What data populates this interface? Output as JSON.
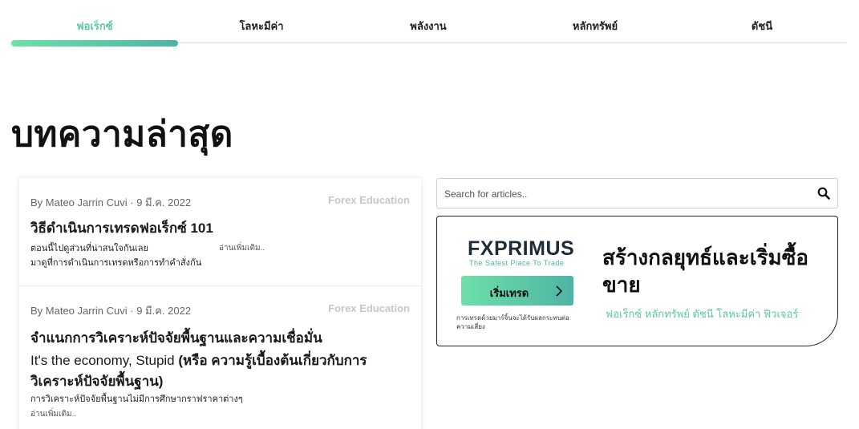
{
  "tabs": [
    {
      "label": "ฟอเร็กซ์",
      "active": true
    },
    {
      "label": "โลหะมีค่า",
      "active": false
    },
    {
      "label": "พลังงาน",
      "active": false
    },
    {
      "label": "หลักทรัพย์",
      "active": false
    },
    {
      "label": "ดัชนี",
      "active": false
    }
  ],
  "page_title": "บทความล่าสุด",
  "articles": [
    {
      "meta": "By Mateo Jarrin Cuvi · 9 มี.ค. 2022",
      "category": "Forex Education",
      "title": "วิธีดำเนินการเทรดฟอเร็กซ์ 101",
      "excerpt_line1": "ตอนนี้ไปดูส่วนที่น่าสนใจกันเลย",
      "excerpt_line2": "มาดูที่การดำเนินการเทรดหรือการทำคำสั่งกัน",
      "read_more": "อ่านเพิ่มเติม.."
    },
    {
      "meta": "By Mateo Jarrin Cuvi · 9 มี.ค. 2022",
      "category": "Forex Education",
      "title": "จำแนกการวิเคราะห์ปัจจัยพื้นฐานและความเชื่อมั่น",
      "subtitle_plain": "It's the economy, Stupid ",
      "subtitle_bold": "(หรือ ความรู้เบื้องต้นเกี่ยวกับการวิเคราะห์ปัจจัยพื้นฐาน)",
      "excerpt_line1": "การวิเคราะห์ปัจจัยพื้นฐานไม่มีการศึกษากราฟราคาต่างๆ",
      "read_more": "อ่านเพิ่มเติม.."
    }
  ],
  "search": {
    "placeholder": "Search for articles..",
    "icon": "search-icon"
  },
  "promo": {
    "logo": "FXPRIMUS",
    "tagline": "The Safest Place To Trade",
    "cta_label": "เริ่มเทรด",
    "disclaimer": "การเทรดด้วยมาร์จิ้นจะได้รับผลกระทบต่อความเสี่ยง",
    "title": "สร้างกลยุทธ์และเริ่มซื้อขาย",
    "tags": "ฟอเร็กซ์ หลักทรัพย์ ดัชนี โลหะมีค่า ฟิวเจอร์"
  },
  "colors": {
    "accent": "#5cc9a0",
    "accent_dark": "#4fb3a4",
    "text": "#1a1a1a",
    "muted": "#c7c7c7"
  }
}
